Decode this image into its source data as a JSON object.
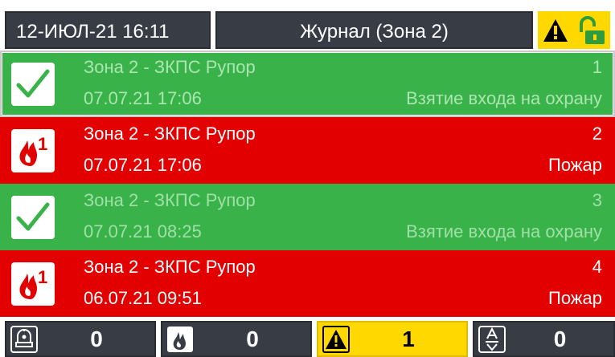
{
  "header": {
    "datetime": "12-ИЮЛ-21  16:11",
    "title": "Журнал (Зона 2)",
    "alert_icon": "warning-triangle-icon",
    "lock_icon": "unlocked-padlock-icon",
    "accent_color": "#ffd800"
  },
  "events": [
    {
      "zone": "Зона 2 - ЗКПС Рупор",
      "number": "1",
      "time": "07.07.21 17:06",
      "event": "Взятие входа на охрану",
      "type": "armed",
      "icon": "checkmark-icon",
      "color": "#3ab24a",
      "selected": true
    },
    {
      "zone": "Зона 2 - ЗКПС Рупор",
      "number": "2",
      "time": "07.07.21 17:06",
      "event": "Пожар",
      "type": "fire",
      "icon": "fire-1-icon",
      "color": "#e30000",
      "selected": false
    },
    {
      "zone": "Зона 2 - ЗКПС Рупор",
      "number": "3",
      "time": "07.07.21 08:25",
      "event": "Взятие входа на охрану",
      "type": "armed",
      "icon": "checkmark-icon",
      "color": "#3ab24a",
      "selected": false
    },
    {
      "zone": "Зона 2 - ЗКПС Рупор",
      "number": "4",
      "time": "06.07.21 09:51",
      "event": "Пожар",
      "type": "fire",
      "icon": "fire-1-icon",
      "color": "#e30000",
      "selected": false
    }
  ],
  "footer": {
    "counters": [
      {
        "name": "siren",
        "icon": "siren-icon",
        "count": "0"
      },
      {
        "name": "fire",
        "icon": "fire-icon",
        "count": "0"
      },
      {
        "name": "fault",
        "icon": "warning-triangle-icon",
        "count": "1"
      },
      {
        "name": "disabled",
        "icon": "disabled-input-icon",
        "count": "0"
      }
    ]
  }
}
